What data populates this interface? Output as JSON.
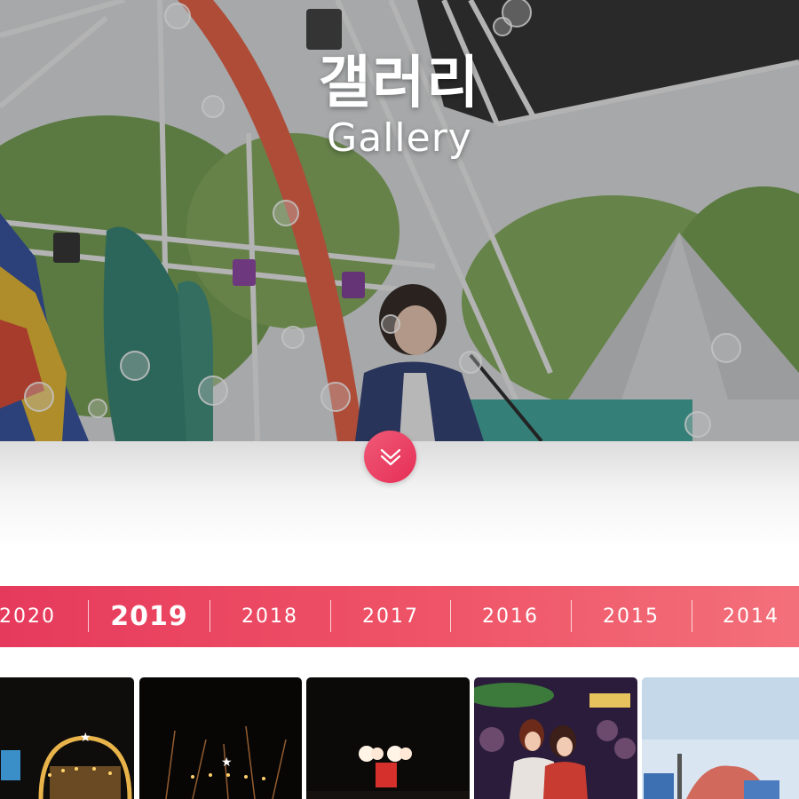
{
  "hero": {
    "title": "갤러리",
    "subtitle": "Gallery"
  },
  "scroll_button": {
    "icon": "double-chevron-down-icon"
  },
  "years": {
    "items": [
      "2020",
      "2019",
      "2018",
      "2017",
      "2016",
      "2015",
      "2014"
    ],
    "active": "2019"
  },
  "colors": {
    "accent": "#e8395b",
    "accent_light": "#f3707a",
    "scroll_button": "#ea3f62"
  },
  "gallery": {
    "thumbnails": [
      {
        "name": "night-stage-arch-photo"
      },
      {
        "name": "fireworks-stage-photo"
      },
      {
        "name": "night-lights-sign-photo"
      },
      {
        "name": "crowd-concert-photo"
      },
      {
        "name": "daytime-stage-balloons-photo"
      }
    ]
  }
}
